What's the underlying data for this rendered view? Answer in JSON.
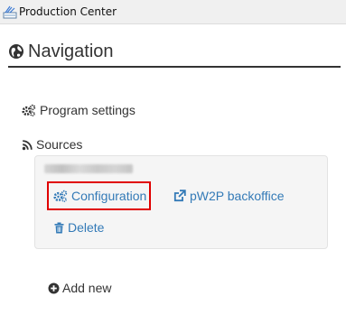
{
  "window": {
    "title": "Production Center",
    "icon": "production-center-app-icon"
  },
  "navigation": {
    "title": "Navigation",
    "icon": "globe-icon"
  },
  "program_settings": {
    "label": "Program settings",
    "icon": "cogs-icon"
  },
  "sources": {
    "label": "Sources",
    "icon": "rss-icon",
    "source_name_redacted": true,
    "actions": {
      "configuration": {
        "label": "Configuration",
        "icon": "cogs-icon",
        "highlighted": true
      },
      "backoffice": {
        "label": "pW2P backoffice",
        "icon": "external-link-icon"
      },
      "delete": {
        "label": "Delete",
        "icon": "trash-icon"
      }
    },
    "add_new": {
      "label": "Add new",
      "icon": "plus-circle-icon"
    }
  },
  "colors": {
    "link": "#337ab7",
    "highlight_border": "#e00000",
    "panel_bg": "#f5f5f5",
    "text": "#333333"
  }
}
